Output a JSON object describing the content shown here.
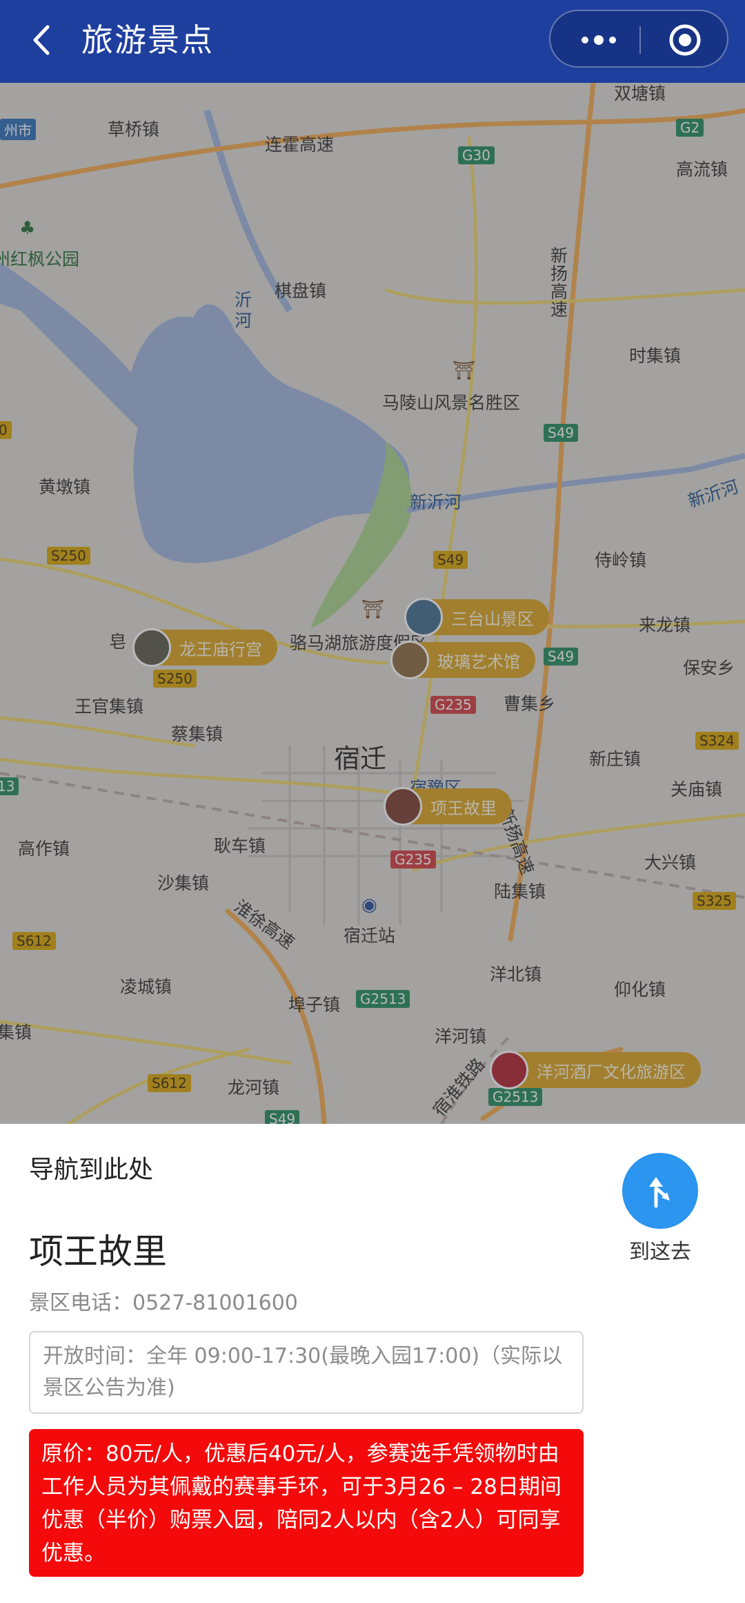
{
  "header": {
    "title": "旅游景点",
    "back_icon": "chevron-left-icon",
    "more_icon": "more-dots-icon",
    "target_icon": "record-circle-icon",
    "bg_color": "#1f3f9f"
  },
  "map": {
    "places": {
      "caoqiao": "草桥镇",
      "lianhuo": "连霍高速",
      "shuangzhuang": "双塘镇",
      "gaoliu": "高流镇",
      "hongfeng": "州红枫公园",
      "qipan": "棋盘镇",
      "yihe": "沂\n河",
      "xinyang_gs": "新\n扬\n高\n速",
      "shiji": "时集镇",
      "malingshan": "马陵山风景名胜区",
      "huangdun": "黄墩镇",
      "xinyihe": "新沂河",
      "xinyihe2": "新沂河",
      "shiling": "侍岭镇",
      "laolong": "来龙镇",
      "baoan": "保安乡",
      "luoma": "骆马湖旅游度假区",
      "caoji": "曹集乡",
      "wangguanji": "王官集镇",
      "caiji": "蔡集镇",
      "suqian": "宿迁",
      "suyu": "宿豫区",
      "xinzhuang": "新庄镇",
      "guanmiao": "关庙镇",
      "gaozuo": "高作镇",
      "qiuche": "耿车镇",
      "dingxing": "大兴镇",
      "shaji": "沙集镇",
      "luji": "陆集镇",
      "suqian_station": "宿迁站",
      "huaixu": "淮徐高速",
      "xinyang2": "新扬高速",
      "lingcheng": "凌城镇",
      "yangbei": "洋北镇",
      "yanghua": "仰化镇",
      "pozi": "埠子镇",
      "yanghe": "洋河镇",
      "jiji": "集镇",
      "longhe": "龙河镇",
      "suhuai": "宿淮铁路",
      "gao": "皂"
    },
    "shields": {
      "g30": "G30",
      "g2": "G2",
      "s49a": "S49",
      "s49b": "S49",
      "s49c": "S49",
      "s49d": "S49",
      "s250a": "S250",
      "s250b": "S250",
      "g235a": "G235",
      "g235b": "G235",
      "s324": "S324",
      "s325": "S325",
      "s612a": "S612",
      "s612b": "S612",
      "g2513a": "G2513",
      "g2513b": "G2513",
      "left13": "13",
      "left0": "0",
      "zhouzhou": "州市"
    },
    "pois": [
      {
        "label": "三台山景区",
        "thumb_color": "#3d6b8c"
      },
      {
        "label": "玻璃艺术馆",
        "thumb_color": "#8a6a3a"
      },
      {
        "label": "龙王庙行宫",
        "thumb_color": "#5a5a4a"
      },
      {
        "label": "项王故里",
        "thumb_color": "#7a3a2a"
      },
      {
        "label": "洋河酒厂文化旅游区",
        "thumb_color": "#b0202a"
      }
    ]
  },
  "panel": {
    "nav_text": "导航到此处",
    "go_label": "到这去",
    "go_icon": "navigate-turn-icon",
    "title": "项王故里",
    "phone": "景区电话：0527-81001600",
    "hours": "开放时间：全年 09:00-17:30(最晚入园17:00)（实际以景区公告为准)",
    "promo": "原价：80元/人，优惠后40元/人，参赛选手凭领物时由工作人员为其佩戴的赛事手环，可于3月26 – 28日期间优惠（半价）购票入园，陪同2人以内（含2人）可同享优惠。",
    "accent_color": "#2b95f0",
    "promo_color": "#f40a0a"
  }
}
